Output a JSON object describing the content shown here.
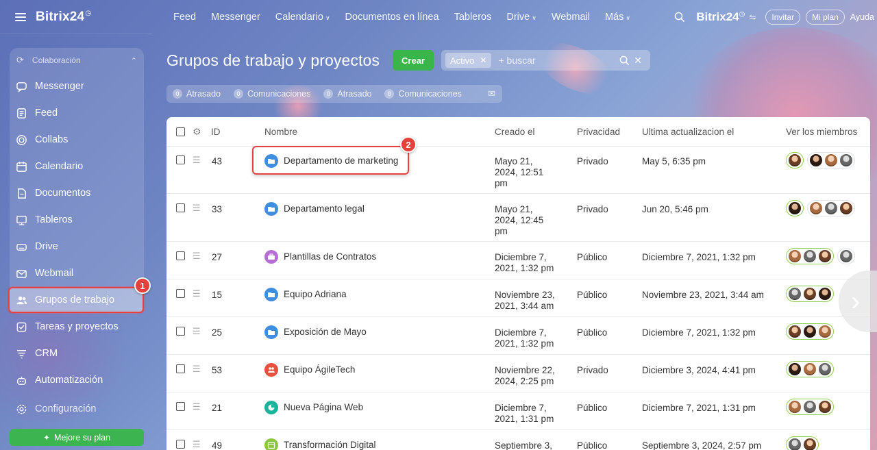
{
  "sidebar": {
    "logo": "Bitrix24",
    "section": "Colaboración",
    "items": [
      {
        "key": "messenger",
        "label": "Messenger",
        "icon": "chat-icon"
      },
      {
        "key": "feed",
        "label": "Feed",
        "icon": "feed-icon"
      },
      {
        "key": "collabs",
        "label": "Collabs",
        "icon": "collabs-icon"
      },
      {
        "key": "calendar",
        "label": "Calendario",
        "icon": "calendar-icon"
      },
      {
        "key": "docs",
        "label": "Documentos",
        "icon": "document-icon"
      },
      {
        "key": "boards",
        "label": "Tableros",
        "icon": "board-icon"
      },
      {
        "key": "drive",
        "label": "Drive",
        "icon": "drive-icon"
      },
      {
        "key": "webmail",
        "label": "Webmail",
        "icon": "mail-icon"
      },
      {
        "key": "groups",
        "label": "Grupos de trabajo",
        "icon": "users-icon",
        "active": true
      },
      {
        "key": "tasks",
        "label": "Tareas y proyectos",
        "icon": "task-icon"
      },
      {
        "key": "crm",
        "label": "CRM",
        "icon": "crm-icon"
      },
      {
        "key": "automation",
        "label": "Automatización",
        "icon": "robot-icon"
      },
      {
        "key": "settings",
        "label": "Configuración",
        "icon": "gear-icon"
      }
    ],
    "upgrade_label": "Mejore su plan",
    "badge_1": "1"
  },
  "topbar": {
    "nav": [
      "Feed",
      "Messenger",
      "Calendario",
      "Documentos en línea",
      "Tableros",
      "Drive",
      "Webmail",
      "Más"
    ],
    "logo": "Bitrix24",
    "invite": "Invitar",
    "plan": "Mi plan",
    "help": "Ayuda"
  },
  "page": {
    "title": "Grupos de trabajo y proyectos",
    "create_label": "Crear",
    "filter_tag": "Activo",
    "search_placeholder": "+ buscar",
    "counters": [
      {
        "num": "0",
        "label": "Atrasado"
      },
      {
        "num": "0",
        "label": "Comunicaciones"
      },
      {
        "num": "0",
        "label": "Atrasado"
      },
      {
        "num": "0",
        "label": "Comunicaciones"
      }
    ],
    "badge_2": "2"
  },
  "table": {
    "headers": {
      "id": "ID",
      "name": "Nombre",
      "created": "Creado el",
      "privacy": "Privacidad",
      "updated": "Ultima actualizacion el",
      "members": "Ver los miembros"
    },
    "rows": [
      {
        "id": "43",
        "name": "Departamento de marketing",
        "icon_color": "#3f8ee0",
        "icon": "folder-icon",
        "created": [
          "Mayo 21,",
          "2024, 12:51",
          "pm"
        ],
        "privacy": "Privado",
        "updated": "May 5, 6:35 pm",
        "members": [
          1,
          3
        ]
      },
      {
        "id": "33",
        "name": "Departamento legal",
        "icon_color": "#3f8ee0",
        "icon": "folder-icon",
        "created": [
          "Mayo 21,",
          "2024, 12:45",
          "pm"
        ],
        "privacy": "Privado",
        "updated": "Jun 20, 5:46 pm",
        "members": [
          1,
          3
        ]
      },
      {
        "id": "27",
        "name": "Plantillas de Contratos",
        "icon_color": "#b56ed3",
        "icon": "briefcase-icon",
        "created": [
          "Diciembre 7,",
          "2021, 1:32 pm"
        ],
        "privacy": "Público",
        "updated": "Diciembre 7, 2021, 1:32 pm",
        "members": [
          3,
          1
        ]
      },
      {
        "id": "15",
        "name": "Equipo Adriana",
        "icon_color": "#3f8ee0",
        "icon": "folder-icon",
        "created": [
          "Noviembre 23,",
          "2021, 3:44 am"
        ],
        "privacy": "Público",
        "updated": "Noviembre 23, 2021, 3:44 am",
        "members": [
          3,
          0
        ]
      },
      {
        "id": "25",
        "name": "Exposición de Mayo",
        "icon_color": "#3f8ee0",
        "icon": "folder-icon",
        "created": [
          "Diciembre 7,",
          "2021, 1:32 pm"
        ],
        "privacy": "Público",
        "updated": "Diciembre 7, 2021, 1:32 pm",
        "members": [
          3,
          0
        ]
      },
      {
        "id": "53",
        "name": "Equipo ÁgileTech",
        "icon_color": "#e8503e",
        "icon": "team-icon",
        "created": [
          "Noviembre 22,",
          "2024, 2:25 pm"
        ],
        "privacy": "Privado",
        "updated": "Diciembre 3, 2024, 4:41 pm",
        "members": [
          3,
          0
        ]
      },
      {
        "id": "21",
        "name": "Nueva Página Web",
        "icon_color": "#1ab39c",
        "icon": "pie-icon",
        "created": [
          "Diciembre 7,",
          "2021, 1:31 pm"
        ],
        "privacy": "Público",
        "updated": "Diciembre 7, 2021, 1:31 pm",
        "members": [
          3,
          0
        ]
      },
      {
        "id": "49",
        "name": "Transformación Digital",
        "icon_color": "#8cc63f",
        "icon": "calendar-icon",
        "created": [
          "Septiembre 3,"
        ],
        "privacy": "Público",
        "updated": "Septiembre 3, 2024, 2:57 pm",
        "members": [
          2,
          0
        ]
      }
    ]
  }
}
